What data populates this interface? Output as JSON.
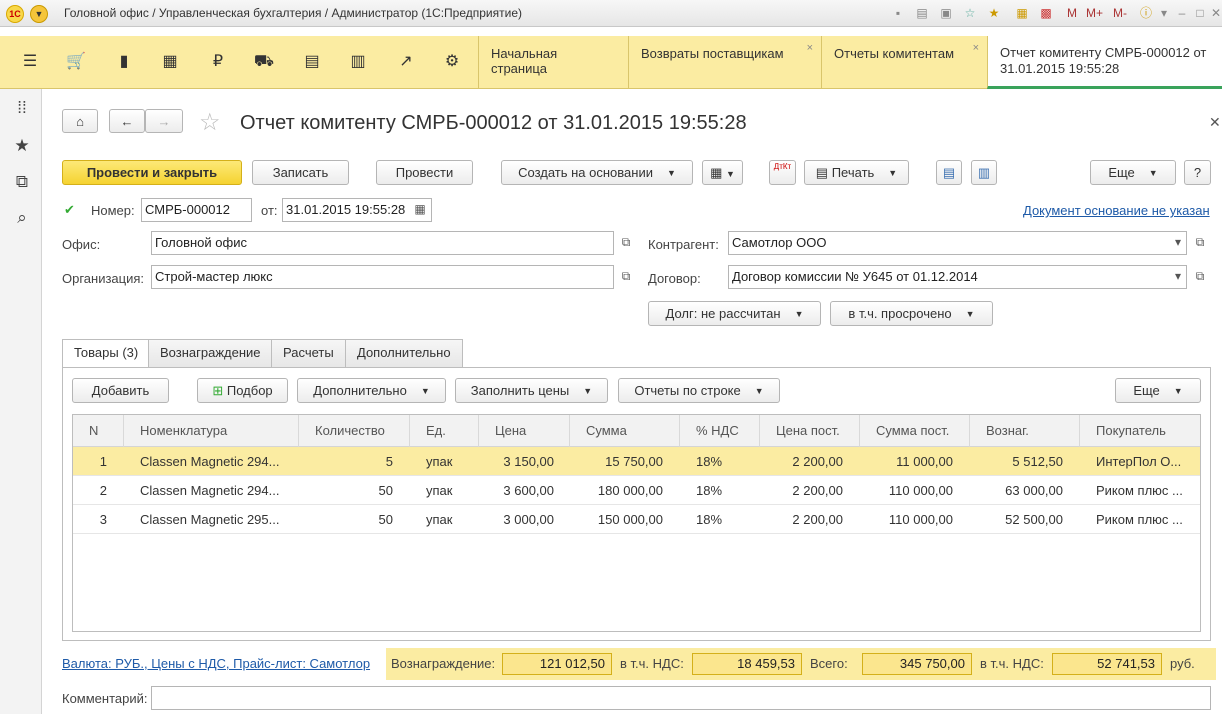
{
  "titlebar": {
    "logo": "1С",
    "title": "Головной офис / Управленческая бухгалтерия / Администратор  (1С:Предприятие)",
    "buttons": [
      "M",
      "M+",
      "M-"
    ]
  },
  "sections": {
    "open_tabs": [
      {
        "label": "Начальная страница"
      },
      {
        "label": "Возвраты поставщикам",
        "close": "×"
      },
      {
        "label": "Отчеты комитентам",
        "close": "×"
      },
      {
        "label": "Отчет комитенту СМРБ-000012 от 31.01.2015 19:55:28"
      }
    ]
  },
  "document": {
    "title": "Отчет комитенту СМРБ-000012 от 31.01.2015 19:55:28",
    "toolbar": {
      "post_close": "Провести и закрыть",
      "save": "Записать",
      "post": "Провести",
      "create_based": "Создать на основании",
      "print": "Печать",
      "more": "Еще",
      "help": "?",
      "dtkt": "ДтКт"
    },
    "number_label": "Номер:",
    "number": "СМРБ-000012",
    "date_label": "от:",
    "date": "31.01.2015 19:55:28",
    "base_doc_link": "Документ основание не указан",
    "office_label": "Офис:",
    "office": "Головной офис",
    "org_label": "Организация:",
    "org": "Строй-мастер люкс",
    "counterparty_label": "Контрагент:",
    "counterparty": "Самотлор ООО",
    "contract_label": "Договор:",
    "contract": "Договор комиссии № У645 от 01.12.2014",
    "debt_btn": "Долг: не рассчитан",
    "overdue_btn": "в т.ч. просрочено"
  },
  "tabs": [
    "Товары (3)",
    "Вознаграждение",
    "Расчеты",
    "Дополнительно"
  ],
  "goods_toolbar": {
    "add": "Добавить",
    "pick": "Подбор",
    "extra": "Дополнительно",
    "fill_prices": "Заполнить цены",
    "row_reports": "Отчеты по строке",
    "more": "Еще"
  },
  "table": {
    "columns": [
      "N",
      "Номенклатура",
      "Количество",
      "Ед.",
      "Цена",
      "Сумма",
      "% НДС",
      "Цена пост.",
      "Сумма пост.",
      "Вознаг.",
      "Покупатель"
    ],
    "rows": [
      {
        "n": "1",
        "item": "Classen Magnetic 294...",
        "qty": "5",
        "unit": "упак",
        "price": "3 150,00",
        "sum": "15 750,00",
        "vat": "18%",
        "sup_price": "2 200,00",
        "sup_sum": "11 000,00",
        "fee": "5 512,50",
        "buyer": "ИнтерПол О..."
      },
      {
        "n": "2",
        "item": "Classen Magnetic 294...",
        "qty": "50",
        "unit": "упак",
        "price": "3 600,00",
        "sum": "180 000,00",
        "vat": "18%",
        "sup_price": "2 200,00",
        "sup_sum": "110 000,00",
        "fee": "63 000,00",
        "buyer": "Риком плюс ..."
      },
      {
        "n": "3",
        "item": "Classen Magnetic 295...",
        "qty": "50",
        "unit": "упак",
        "price": "3 000,00",
        "sum": "150 000,00",
        "vat": "18%",
        "sup_price": "2 200,00",
        "sup_sum": "110 000,00",
        "fee": "52 500,00",
        "buyer": "Риком плюс ..."
      }
    ]
  },
  "footer": {
    "currency_link": "Валюта: РУБ., Цены с НДС, Прайс-лист: Самотлор",
    "fee_label": "Вознаграждение:",
    "fee": "121 012,50",
    "fee_vat_label": "в т.ч. НДС:",
    "fee_vat": "18 459,53",
    "total_label": "Всего:",
    "total": "345 750,00",
    "total_vat_label": "в т.ч. НДС:",
    "total_vat": "52 741,53",
    "currency": "руб.",
    "comment_label": "Комментарий:"
  }
}
